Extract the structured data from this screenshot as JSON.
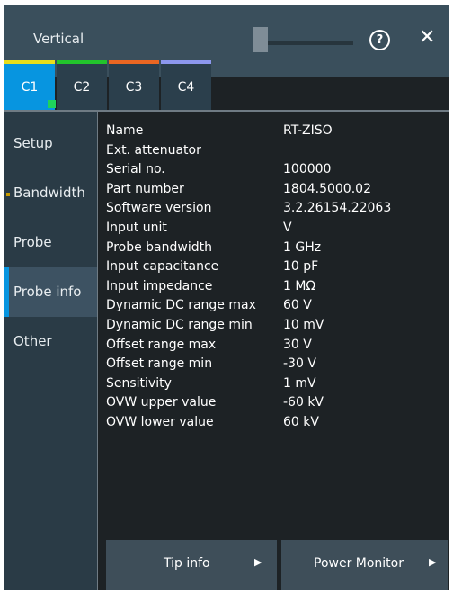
{
  "window": {
    "title": "Vertical"
  },
  "tabs": [
    {
      "label": "C1",
      "color": "#e8de1c"
    },
    {
      "label": "C2",
      "color": "#22c42c"
    },
    {
      "label": "C3",
      "color": "#ea6622"
    },
    {
      "label": "C4",
      "color": "#8c97ee"
    }
  ],
  "active_tab": "C1",
  "sidebar": {
    "items": [
      {
        "label": "Setup"
      },
      {
        "label": "Bandwidth"
      },
      {
        "label": "Probe"
      },
      {
        "label": "Probe info"
      },
      {
        "label": "Other"
      }
    ],
    "active": "Probe info"
  },
  "probe_info": {
    "rows": [
      {
        "key": "Name",
        "value": "RT-ZISO"
      },
      {
        "key": "Ext. attenuator",
        "value": ""
      },
      {
        "key": "Serial no.",
        "value": "100000"
      },
      {
        "key": "Part number",
        "value": "1804.5000.02"
      },
      {
        "key": "Software version",
        "value": "3.2.26154.22063"
      },
      {
        "key": "Input unit",
        "value": "V"
      },
      {
        "key": "Probe bandwidth",
        "value": "1 GHz"
      },
      {
        "key": "Input capacitance",
        "value": "10 pF"
      },
      {
        "key": "Input impedance",
        "value": "1 MΩ"
      },
      {
        "key": "Dynamic DC range max",
        "value": "60 V"
      },
      {
        "key": "Dynamic DC range min",
        "value": "10 mV"
      },
      {
        "key": "Offset range max",
        "value": "30 V"
      },
      {
        "key": "Offset range min",
        "value": "-30 V"
      },
      {
        "key": "Sensitivity",
        "value": "1 mV"
      },
      {
        "key": "OVW upper value",
        "value": "-60 kV"
      },
      {
        "key": "OVW lower value",
        "value": "60 kV"
      }
    ]
  },
  "buttons": {
    "tip_info": "Tip info",
    "power_monitor": "Power Monitor",
    "arrow_icon": "triangle-right-icon"
  },
  "icons": {
    "help": "?",
    "close": "✕",
    "arrow": "▶"
  }
}
